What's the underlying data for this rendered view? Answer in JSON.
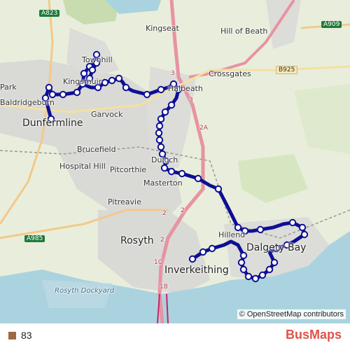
{
  "map": {
    "labels": {
      "dunfermline": "Dunfermline",
      "kingseat": "Kingseat",
      "hill_of_beath": "Hill of Beath",
      "crossgates": "Crossgates",
      "townhill": "Townhill",
      "kingsmuir": "Kingsmuir",
      "garvock": "Garvock",
      "brucefield": "Brucefield",
      "hospital_hill": "Hospital Hill",
      "pitcorthie": "Pitcorthie",
      "masterton": "Masterton",
      "pitreavie": "Pitreavie",
      "rosyth": "Rosyth",
      "inverkeithing": "Inverkeithing",
      "rosyth_dockyard": "Rosyth Dockyard",
      "baldridgeburn": "Baldridgeburn",
      "dalgety_bay": "Dalgety Bay",
      "duloch": "Duloch",
      "halbeath": "Halbeath",
      "hillend": "Hillend",
      "park": "Park"
    },
    "roads": {
      "a823": "A823",
      "a909": "A909",
      "b925": "B925",
      "a985": "A985",
      "m90_2a": "2A",
      "m90_2": "2",
      "m90_1c": "1C",
      "m90_1b": "1B",
      "j3": "3"
    },
    "attribution": "© OpenStreetMap contributors"
  },
  "legend": {
    "route_number": "83",
    "swatch_color": "#9c6b44"
  },
  "brand": {
    "part1": "Bus",
    "part2": "Maps"
  },
  "colors": {
    "route": "#0d0f94",
    "sea": "#aad3df",
    "urban": "#d9d9d9",
    "field": "#e9f0d8",
    "motorway": "#e892a2"
  }
}
